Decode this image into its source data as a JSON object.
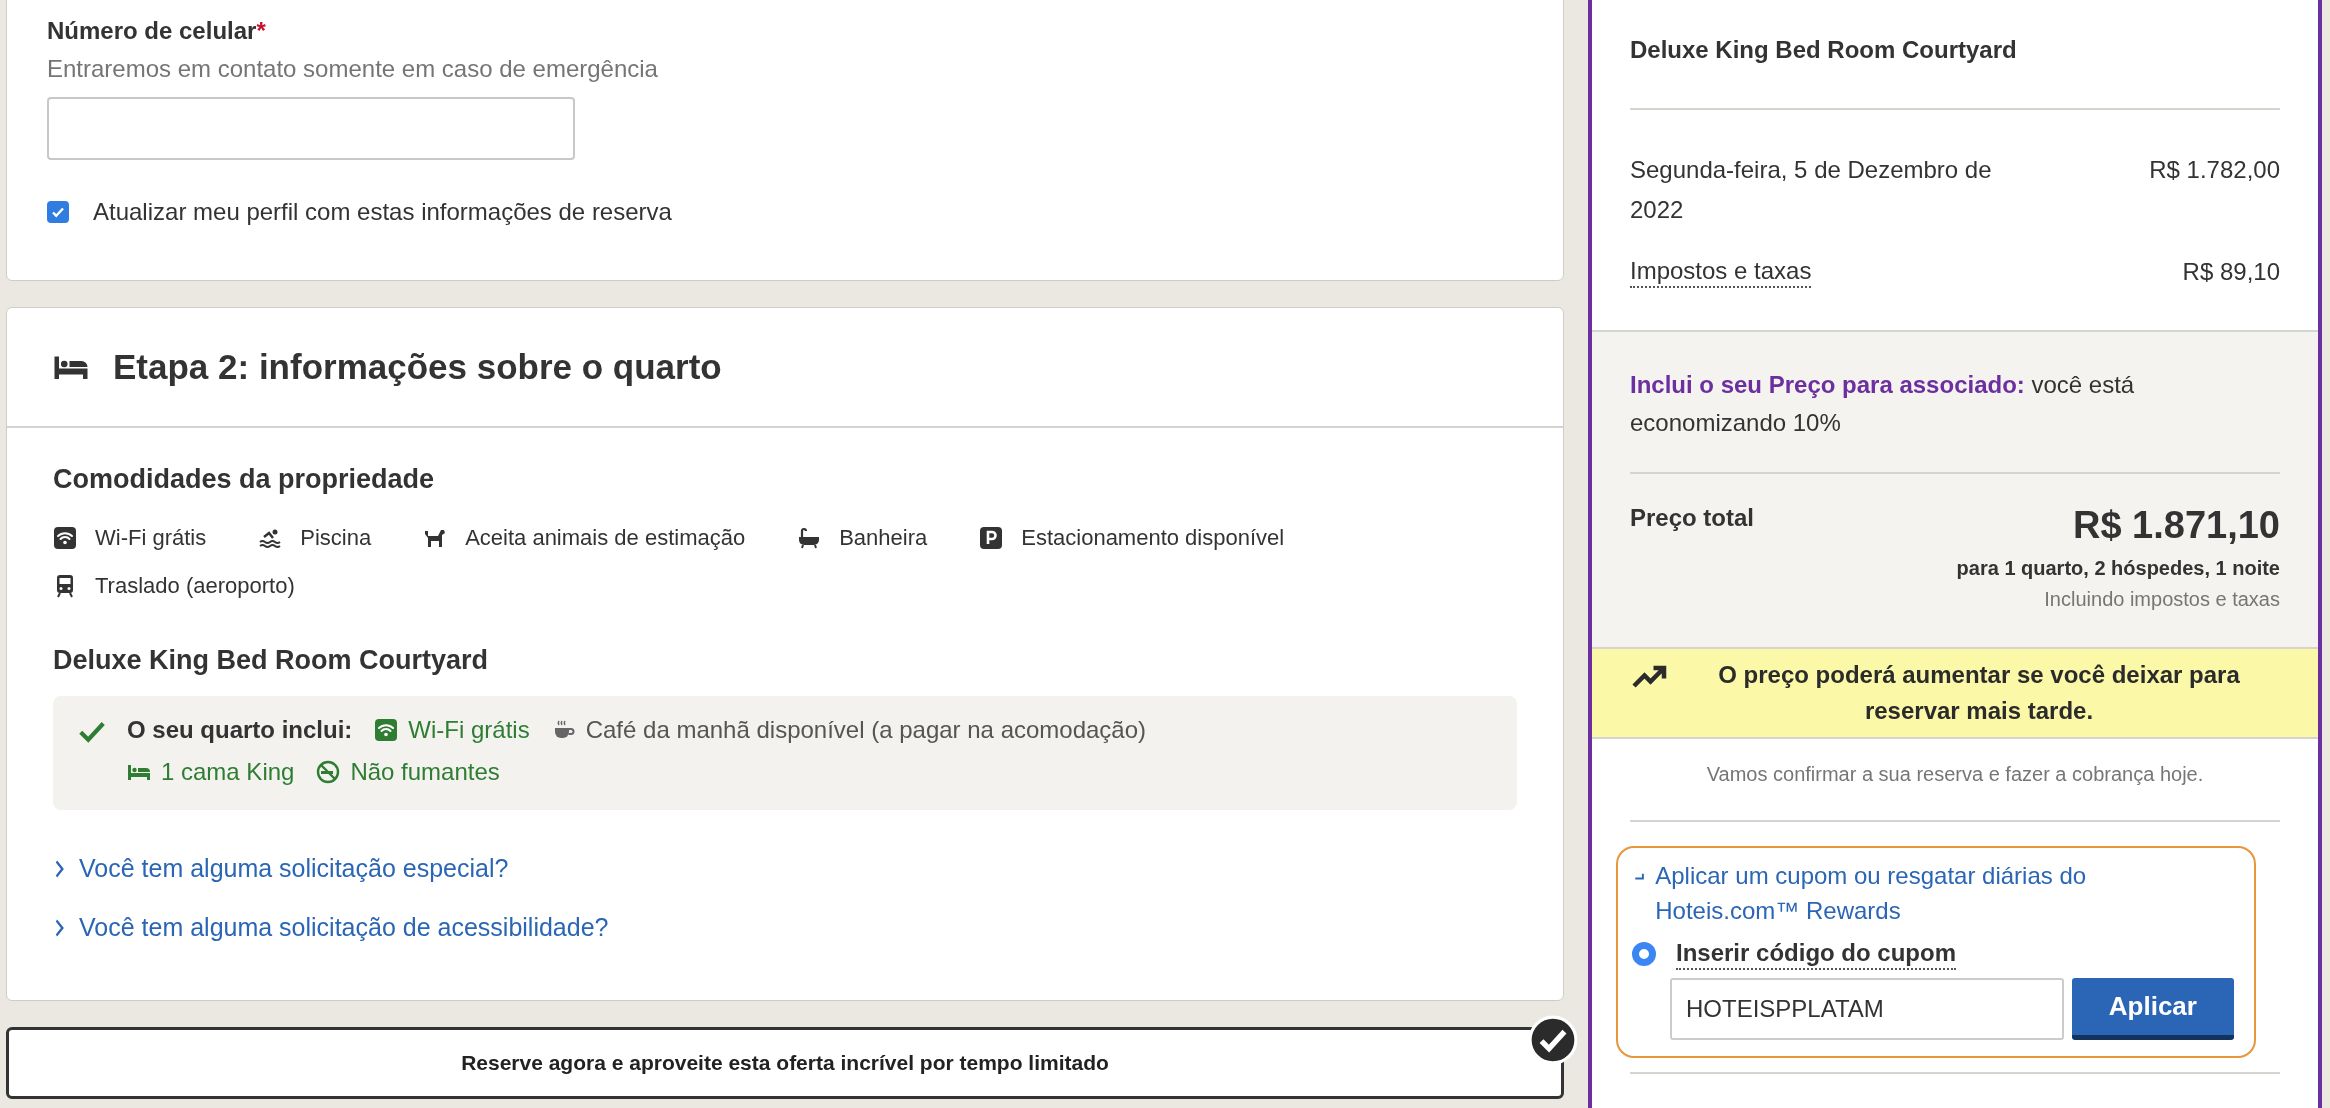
{
  "contact": {
    "label": "Número de celular",
    "required_mark": "*",
    "hint": "Entraremos em contato somente em caso de emergência",
    "update_profile": {
      "label": "Atualizar meu perfil com estas informações de reserva",
      "checked": true
    }
  },
  "step2": {
    "title": "Etapa 2: informações sobre o quarto",
    "amenities_heading": "Comodidades da propriedade",
    "amenities": [
      {
        "label": "Wi-Fi grátis"
      },
      {
        "label": "Piscina"
      },
      {
        "label": "Aceita animais de estimação"
      },
      {
        "label": "Banheira"
      },
      {
        "label": "Estacionamento disponível"
      },
      {
        "label": "Traslado (aeroporto)"
      }
    ],
    "room": {
      "name": "Deluxe King Bed Room Courtyard",
      "included_label": "O seu quarto inclui:",
      "included": [
        {
          "label": "Wi-Fi grátis",
          "highlighted": true
        },
        {
          "label": "Café da manhã disponível (a pagar na acomodação)",
          "highlighted": false
        },
        {
          "label": "1 cama King",
          "highlighted": true
        },
        {
          "label": "Não fumantes",
          "highlighted": true
        }
      ]
    },
    "links": [
      "Você tem alguma solicitação especial?",
      "Você tem alguma solicitação de acessibilidade?"
    ]
  },
  "banner": {
    "text": "Reserve agora e aproveite esta oferta incrível por tempo limitado"
  },
  "summary": {
    "room_name": "Deluxe King Bed Room Courtyard",
    "lines": [
      {
        "label": "Segunda-feira, 5 de Dezembro de 2022",
        "amount": "R$ 1.782,00",
        "dotted": false
      },
      {
        "label": "Impostos e taxas",
        "amount": "R$ 89,10",
        "dotted": true
      }
    ],
    "member": "**Inclui o seu Preço para associado:** você está economizando 10%",
    "total": {
      "label": "Preço total",
      "amount": "R$ 1.871,10",
      "detail": "para 1 quarto, 2 hóspedes, 1 noite",
      "note": "Incluindo impostos e taxas"
    },
    "alert": "O preço poderá aumentar se você deixar para reservar mais tarde.",
    "confirm": "Vamos confirmar a sua reserva e fazer a cobrança hoje.",
    "coupon": {
      "link": "Aplicar um cupom ou resgatar diárias do Hoteis.com™ Rewards",
      "option": {
        "label": "Inserir código do cupom",
        "selected": true
      },
      "code": "HOTEISPPLATAM",
      "button": "Aplicar"
    }
  }
}
